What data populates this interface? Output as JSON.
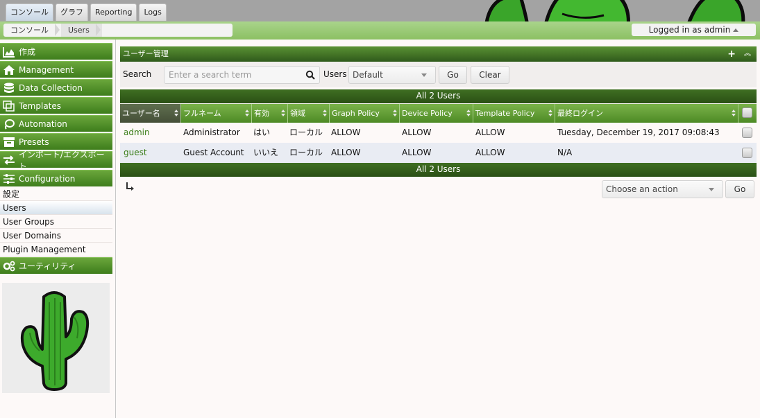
{
  "top_tabs": [
    {
      "label": "コンソール",
      "selected": true
    },
    {
      "label": "グラフ",
      "selected": false
    },
    {
      "label": "Reporting",
      "selected": false
    },
    {
      "label": "Logs",
      "selected": false
    }
  ],
  "breadcrumb": [
    "コンソール",
    "Users"
  ],
  "login_status": "Logged in as admin",
  "sidebar": {
    "menus": [
      {
        "label": "作成",
        "icon": "chart-area-icon"
      },
      {
        "label": "Management",
        "icon": "home-icon"
      },
      {
        "label": "Data Collection",
        "icon": "database-icon"
      },
      {
        "label": "Templates",
        "icon": "copy-icon"
      },
      {
        "label": "Automation",
        "icon": "lasso-icon"
      },
      {
        "label": "Presets",
        "icon": "archive-icon"
      },
      {
        "label": "インポート/エクスポート",
        "icon": "exchange-icon"
      },
      {
        "label": "Configuration",
        "icon": "sliders-icon"
      }
    ],
    "config_items": [
      {
        "label": "設定",
        "selected": false
      },
      {
        "label": "Users",
        "selected": true
      },
      {
        "label": "User Groups",
        "selected": false
      },
      {
        "label": "User Domains",
        "selected": false
      },
      {
        "label": "Plugin Management",
        "selected": false
      }
    ],
    "utilities": {
      "label": "ユーティリティ",
      "icon": "cogs-icon"
    }
  },
  "panel": {
    "title": "ユーザー管理",
    "add_icon": "plus-icon",
    "collapse_icon": "chevron-up-icon"
  },
  "filter": {
    "search_label": "Search",
    "search_placeholder": "Enter a search term",
    "users_label": "Users",
    "users_value": "Default",
    "go_label": "Go",
    "clear_label": "Clear"
  },
  "table": {
    "nav_text": "All 2 Users",
    "columns": [
      "ユーザー名",
      "フルネーム",
      "有効",
      "領域",
      "Graph Policy",
      "Device Policy",
      "Template Policy",
      "最終ログイン"
    ],
    "rows": [
      [
        "admin",
        "Administrator",
        "はい",
        "ローカル",
        "ALLOW",
        "ALLOW",
        "ALLOW",
        "Tuesday, December 19, 2017 09:08:43"
      ],
      [
        "guest",
        "Guest Account",
        "いいえ",
        "ローカル",
        "ALLOW",
        "ALLOW",
        "ALLOW",
        "N/A"
      ]
    ]
  },
  "actions": {
    "placeholder": "Choose an action",
    "go_label": "Go"
  },
  "colors": {
    "accent_green": "#4d8a25",
    "link_green": "#3a7d18",
    "nav_dark_green": "#2a4f15",
    "row_alt": "#e9ecf3"
  }
}
